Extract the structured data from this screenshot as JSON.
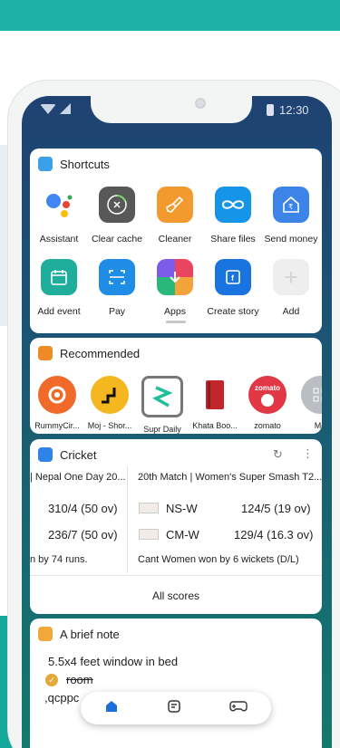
{
  "status": {
    "time": "12:30"
  },
  "shortcuts": {
    "title": "Shortcuts",
    "apps": [
      {
        "label": "Assistant",
        "icon": "google-assistant-icon"
      },
      {
        "label": "Clear cache",
        "icon": "clear-cache-icon"
      },
      {
        "label": "Cleaner",
        "icon": "broom-icon"
      },
      {
        "label": "Share files",
        "icon": "share-files-icon"
      },
      {
        "label": "Send money",
        "icon": "send-money-icon"
      },
      {
        "label": "Add event",
        "icon": "calendar-icon"
      },
      {
        "label": "Pay",
        "icon": "scan-pay-icon"
      },
      {
        "label": "Apps",
        "icon": "apps-icon"
      },
      {
        "label": "Create story",
        "icon": "create-story-icon"
      },
      {
        "label": "Add",
        "icon": "plus-icon"
      }
    ]
  },
  "recommended": {
    "title": "Recommended",
    "apps": [
      {
        "label": "RummyCir..."
      },
      {
        "label": "Moj - Shor..."
      },
      {
        "label": "Supr Daily"
      },
      {
        "label": "Khata Boo..."
      },
      {
        "label": "zomato",
        "badge": "zomato"
      },
      {
        "label": "Mo"
      }
    ]
  },
  "cricket": {
    "title": "Cricket",
    "col1_header": "| Nepal One Day 20...",
    "col1_score1": "310/4 (50 ov)",
    "col1_score2": "236/7 (50 ov)",
    "col1_result": "n by 74 runs.",
    "col2_header": "20th Match | Women's Super Smash T2...",
    "team1": "NS-W",
    "team1_score": "124/5 (19 ov)",
    "team2": "CM-W",
    "team2_score": "129/4 (16.3 ov)",
    "col2_result": "Cant Women won by 6 wickets (D/L)",
    "all_scores": "All scores"
  },
  "note": {
    "title": "A brief note",
    "line1": "5.5x4 feet window in bed",
    "item_done": "room",
    "line3": ",qcppc"
  }
}
